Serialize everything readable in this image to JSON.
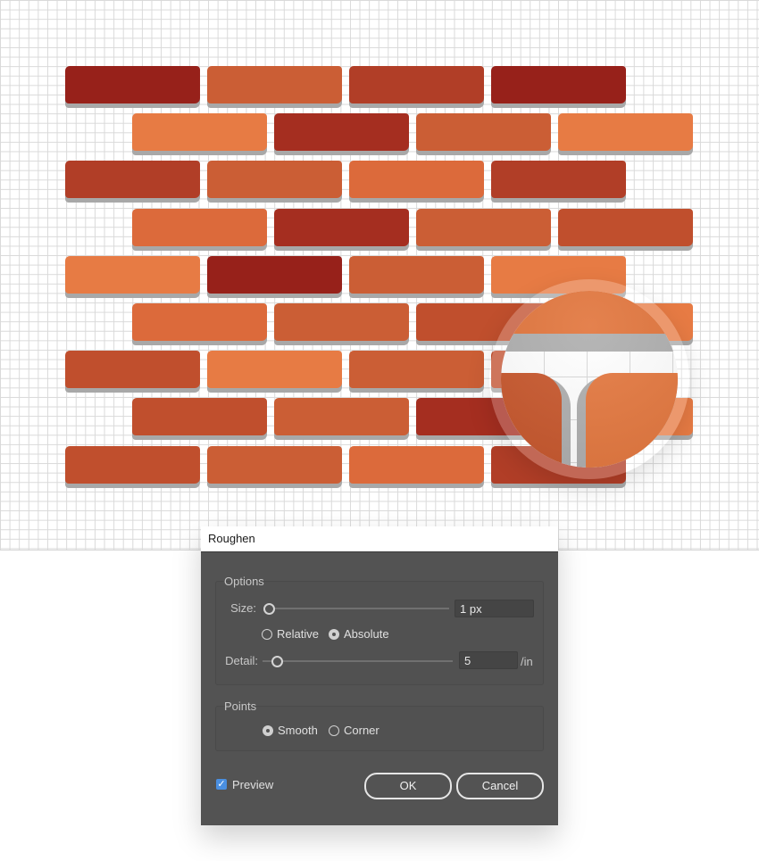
{
  "canvas": {
    "brick_rows": [
      {
        "offset": "left",
        "colors": [
          "#97211a",
          "#cb5e35",
          "#b13e27",
          "#97211a"
        ]
      },
      {
        "offset": "right",
        "colors": [
          "#e77b44",
          "#a52e20",
          "#cb5e35",
          "#e77b44"
        ]
      },
      {
        "offset": "left",
        "colors": [
          "#b13e27",
          "#cb5e35",
          "#dc6a3b",
          "#b13e27"
        ]
      },
      {
        "offset": "right",
        "colors": [
          "#dc6a3b",
          "#a52e20",
          "#cb5e35",
          "#c04f2d"
        ]
      },
      {
        "offset": "left",
        "colors": [
          "#e77b44",
          "#97211a",
          "#cb5e35",
          "#e77b44"
        ]
      },
      {
        "offset": "right",
        "colors": [
          "#dc6a3b",
          "#cb5e35",
          "#c04f2d",
          "#e77b44"
        ]
      },
      {
        "offset": "left",
        "colors": [
          "#c04f2d",
          "#e77b44",
          "#cb5e35",
          "#c04f2d"
        ]
      },
      {
        "offset": "right",
        "colors": [
          "#c04f2d",
          "#cb5e35",
          "#a52e20",
          "#e77b44"
        ]
      },
      {
        "offset": "left",
        "colors": [
          "#c04f2d",
          "#cb5e35",
          "#dc6a3b",
          "#b13e27"
        ]
      }
    ],
    "brick_shadow_color": "#a8a8a8",
    "grid_color": "#d9d9d9",
    "magnifier": {
      "icon": "magnifier-lens"
    }
  },
  "dialog": {
    "title": "Roughen",
    "options": {
      "group_label": "Options",
      "size_label": "Size:",
      "size_value": "1 px",
      "size_slider_fraction": 0.0,
      "relative_label": "Relative",
      "absolute_label": "Absolute",
      "mode_selected": "Absolute",
      "detail_label": "Detail:",
      "detail_value": "5",
      "detail_unit": "/in",
      "detail_slider_fraction": 0.05
    },
    "points": {
      "group_label": "Points",
      "smooth_label": "Smooth",
      "corner_label": "Corner",
      "selected": "Smooth"
    },
    "preview_label": "Preview",
    "preview_checked": true,
    "ok_label": "OK",
    "cancel_label": "Cancel",
    "accent_color": "#4a8fe0"
  }
}
